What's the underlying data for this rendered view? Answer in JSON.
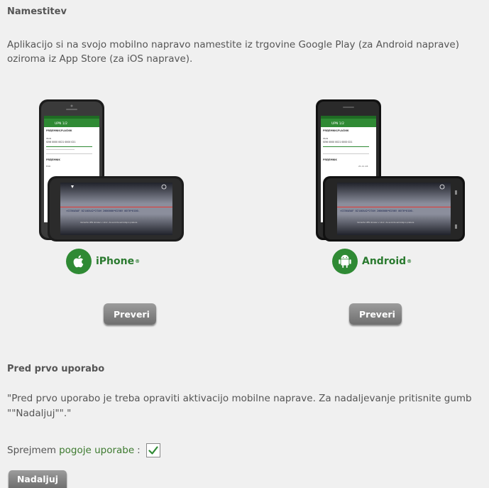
{
  "install": {
    "title": "Namestitev",
    "text": "Aplikacijo si na svojo mobilno napravo namestite iz trgovine Google Play (za Android naprave) oziroma iz App Store (za iOS naprave)."
  },
  "phone_screen": {
    "app_title": "UPN 1/2",
    "section_payer": "PREJEMNIK/PLAČNIK",
    "account_label": "IBAN",
    "account_value": "SI56 0000 0021 0000 021",
    "section_receiver": "PREJEMNIK",
    "amount_label": "EUR",
    "date_value": "21.11.16",
    "scan_code": "<SI56A5AF 02146A42*27AH 2000000*6256V 0076*0100-",
    "scan_hint": "Usmerite UPN obrazec v okvir, da se koda samodejno prebere"
  },
  "platforms": {
    "ios": {
      "label": "iPhone",
      "mark": "®",
      "button": "Preveri"
    },
    "android": {
      "label": "Android",
      "mark": "®",
      "button": "Preveri"
    }
  },
  "first_use": {
    "title": "Pred prvo uporabo",
    "text": "\"Pred prvo uporabo je treba opraviti aktivacijo mobilne naprave. Za nadaljevanje pritisnite gumb \"\"Nadaljuj\"\".\"",
    "accept_prefix": "Sprejmem",
    "terms_link": "pogoje uporabe",
    "accept_suffix": ":",
    "accepted": true,
    "continue_button": "Nadaljuj"
  },
  "colors": {
    "background": "#f0f0f0",
    "accent_green": "#2f8a34",
    "button_gray": "#7d7d7d"
  }
}
